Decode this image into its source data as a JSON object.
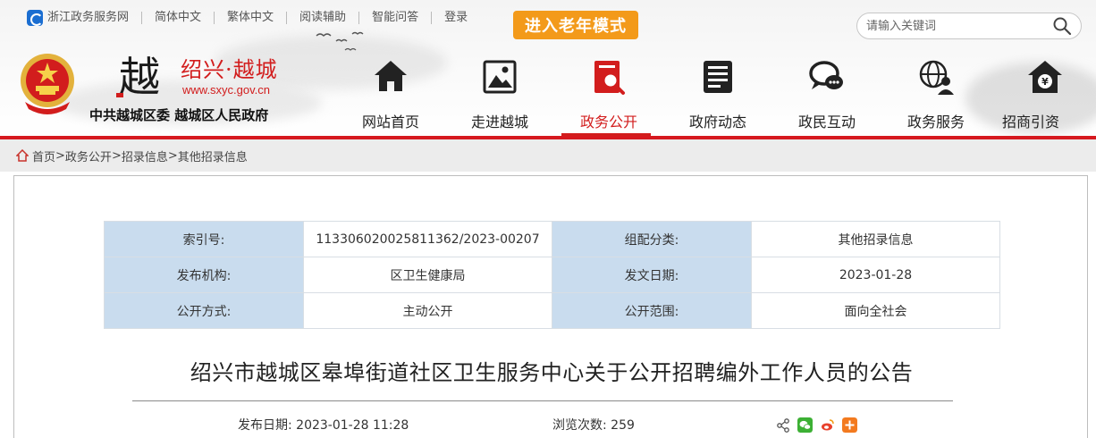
{
  "topbar": {
    "site_name": "浙江政务服务网",
    "items": [
      "简体中文",
      "繁体中文",
      "阅读辅助",
      "智能问答",
      "登录"
    ],
    "elder_mode": "进入老年模式"
  },
  "search": {
    "placeholder": "请输入关键词"
  },
  "brand": {
    "logo_char": "越",
    "name": "绍兴·越城",
    "url": "www.sxyc.gov.cn",
    "subtitle": "中共越城区委 越城区人民政府"
  },
  "nav": {
    "items": [
      {
        "label": "网站首页",
        "icon": "home-icon"
      },
      {
        "label": "走进越城",
        "icon": "picture-icon"
      },
      {
        "label": "政务公开",
        "icon": "document-search-icon"
      },
      {
        "label": "政府动态",
        "icon": "news-icon"
      },
      {
        "label": "政民互动",
        "icon": "chat-icon"
      },
      {
        "label": "政务服务",
        "icon": "globe-user-icon"
      },
      {
        "label": "招商引资",
        "icon": "house-yen-icon"
      }
    ],
    "active": "政务公开"
  },
  "breadcrumb": [
    "首页",
    "政务公开",
    "招录信息",
    "其他招录信息"
  ],
  "meta": {
    "rows": [
      [
        {
          "k": "索引号:",
          "v": "113306020025811362/2023-00207"
        },
        {
          "k": "组配分类:",
          "v": "其他招录信息"
        }
      ],
      [
        {
          "k": "发布机构:",
          "v": "区卫生健康局"
        },
        {
          "k": "发文日期:",
          "v": "2023-01-28"
        }
      ],
      [
        {
          "k": "公开方式:",
          "v": "主动公开"
        },
        {
          "k": "公开范围:",
          "v": "面向全社会"
        }
      ]
    ]
  },
  "article": {
    "title": "绍兴市越城区皋埠街道社区卫生服务中心关于公开招聘编外工作人员的公告",
    "publish_label": "发布日期:",
    "publish_date": "2023-01-28 11:28",
    "views_label": "浏览次数:",
    "views": "259"
  },
  "colors": {
    "accent_red": "#d21d1d",
    "elder_orange": "#f39a1a",
    "meta_key_bg": "#c9dcee"
  }
}
